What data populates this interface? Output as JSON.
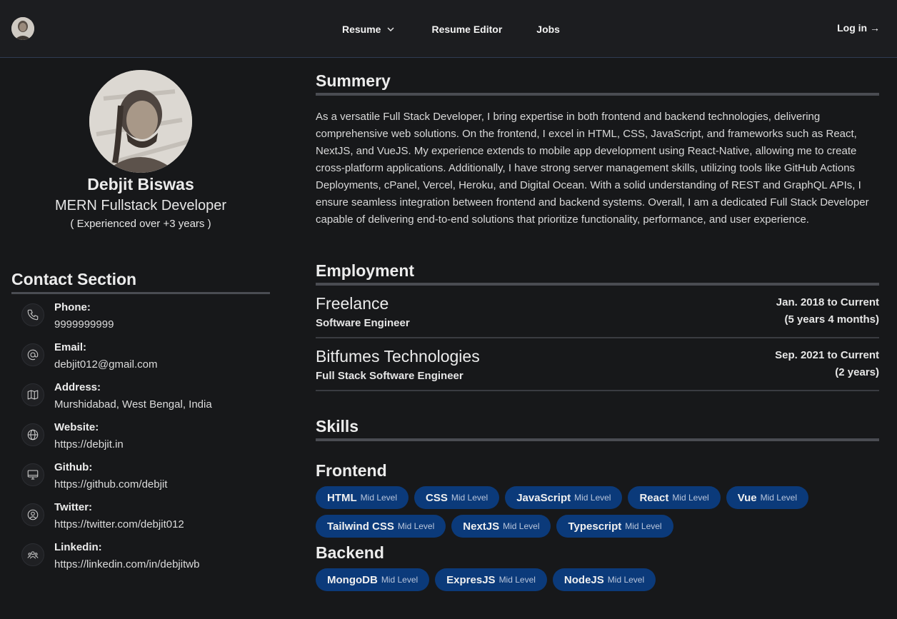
{
  "nav": {
    "items": [
      {
        "label": "Resume"
      },
      {
        "label": "Resume Editor"
      },
      {
        "label": "Jobs"
      }
    ],
    "login": "Log in →"
  },
  "profile": {
    "name": "Debjit Biswas",
    "role": "MERN Fullstack Developer",
    "experience": "( Experienced over +3 years )"
  },
  "contact": {
    "heading": "Contact Section",
    "items": [
      {
        "label": "Phone:",
        "value": "9999999999",
        "icon": "phone-icon"
      },
      {
        "label": "Email:",
        "value": "debjit012@gmail.com",
        "icon": "at-icon"
      },
      {
        "label": "Address:",
        "value": "Murshidabad, West Bengal, India",
        "icon": "map-icon"
      },
      {
        "label": "Website:",
        "value": "https://debjit.in",
        "icon": "globe-icon"
      },
      {
        "label": "Github:",
        "value": "https://github.com/debjit",
        "icon": "desktop-icon"
      },
      {
        "label": "Twitter:",
        "value": "https://twitter.com/debjit012",
        "icon": "user-circle-icon"
      },
      {
        "label": "Linkedin:",
        "value": "https://linkedin.com/in/debjitwb",
        "icon": "users-icon"
      }
    ]
  },
  "summary": {
    "heading": "Summery",
    "text": "As a versatile Full Stack Developer, I bring expertise in both frontend and backend technologies, delivering comprehensive web solutions. On the frontend, I excel in HTML, CSS, JavaScript, and frameworks such as React, NextJS, and VueJS. My experience extends to mobile app development using React-Native, allowing me to create cross-platform applications. Additionally, I have strong server management skills, utilizing tools like GitHub Actions Deployments, cPanel, Vercel, Heroku, and Digital Ocean. With a solid understanding of REST and GraphQL APIs, I ensure seamless integration between frontend and backend systems. Overall, I am a dedicated Full Stack Developer capable of delivering end-to-end solutions that prioritize functionality, performance, and user experience."
  },
  "employment": {
    "heading": "Employment",
    "jobs": [
      {
        "company": "Freelance",
        "title": "Software Engineer",
        "date": "Jan. 2018 to Current",
        "duration": "(5 years 4 months)"
      },
      {
        "company": "Bitfumes Technologies",
        "title": "Full Stack Software Engineer",
        "date": "Sep. 2021 to Current",
        "duration": "(2 years)"
      }
    ]
  },
  "skills": {
    "heading": "Skills",
    "groups": [
      {
        "name": "Frontend",
        "items": [
          {
            "name": "HTML",
            "level": "Mid Level"
          },
          {
            "name": "CSS",
            "level": "Mid Level"
          },
          {
            "name": "JavaScript",
            "level": "Mid Level"
          },
          {
            "name": "React",
            "level": "Mid Level"
          },
          {
            "name": "Vue",
            "level": "Mid Level"
          },
          {
            "name": "Tailwind CSS",
            "level": "Mid Level"
          },
          {
            "name": "NextJS",
            "level": "Mid Level"
          },
          {
            "name": "Typescript",
            "level": "Mid Level"
          }
        ]
      },
      {
        "name": "Backend",
        "items": [
          {
            "name": "MongoDB",
            "level": "Mid Level"
          },
          {
            "name": "ExpresJS",
            "level": "Mid Level"
          },
          {
            "name": "NodeJS",
            "level": "Mid Level"
          }
        ]
      }
    ]
  },
  "colors": {
    "background": "#17181a",
    "badge": "#0b3a7a",
    "rule": "#4a4c52"
  }
}
